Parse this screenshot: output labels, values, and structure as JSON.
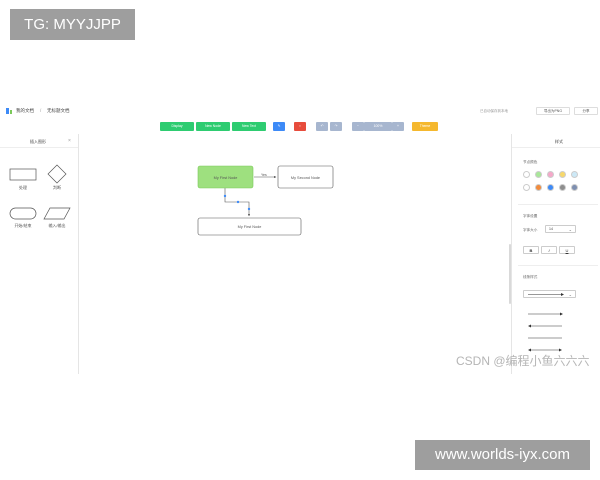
{
  "overlay": {
    "tg_badge": "TG: MYYJJPP",
    "csdn_watermark": "CSDN @编程小鱼六六六",
    "site_badge": "www.worlds-iyx.com"
  },
  "topbar": {
    "home": "我的文档",
    "separator": "/",
    "doc_title": "无标题文档",
    "saved_note": "已自动保存到本地",
    "export_label": "导出为PNG",
    "share_label": "分享"
  },
  "toolbar": {
    "display_label": "Display",
    "new_node_label": "New Node",
    "new_text_label": "New Text",
    "zoom_value": "100%",
    "theme_label": "Theme"
  },
  "left_panel": {
    "title": "插入图形",
    "close": "×",
    "shapes": [
      {
        "label": "处理",
        "icon": "rect-shape-icon"
      },
      {
        "label": "判断",
        "icon": "diamond-shape-icon"
      },
      {
        "label": "开始/结束",
        "icon": "terminator-shape-icon"
      },
      {
        "label": "输入/输出",
        "icon": "parallelogram-shape-icon"
      }
    ]
  },
  "canvas": {
    "nodes": [
      {
        "label": "My First Node",
        "fill": "#9ee07f",
        "stroke": "#7bc95a"
      },
      {
        "label": "My Second Node",
        "fill": "#ffffff",
        "stroke": "#555555"
      },
      {
        "label": "My First Node",
        "fill": "#ffffff",
        "stroke": "#555555"
      }
    ],
    "edge_label": "Yes"
  },
  "right_panel": {
    "title": "样式",
    "node_color_label": "节点颜色",
    "colors_row1": [
      "#ffffff",
      "#a9e79a",
      "#f5a8c9",
      "#f7d86b",
      "#cde9f7"
    ],
    "colors_row2": [
      "#ffffff",
      "#f28b3c",
      "#3d8af7",
      "#8e8e8e",
      "#7e8fb0"
    ],
    "font_label": "字体设置",
    "font_size_label": "字体大小",
    "font_size_value": "14",
    "bold": "B",
    "italic": "I",
    "underline": "U",
    "line_style_label": "线条样式",
    "line_options_count": "4"
  },
  "colors": {
    "accent_green": "#2ecc71",
    "accent_blue": "#3d8af7",
    "accent_red": "#e74c3c",
    "accent_orange": "#f5b82e",
    "node_green": "#9ee07f"
  }
}
